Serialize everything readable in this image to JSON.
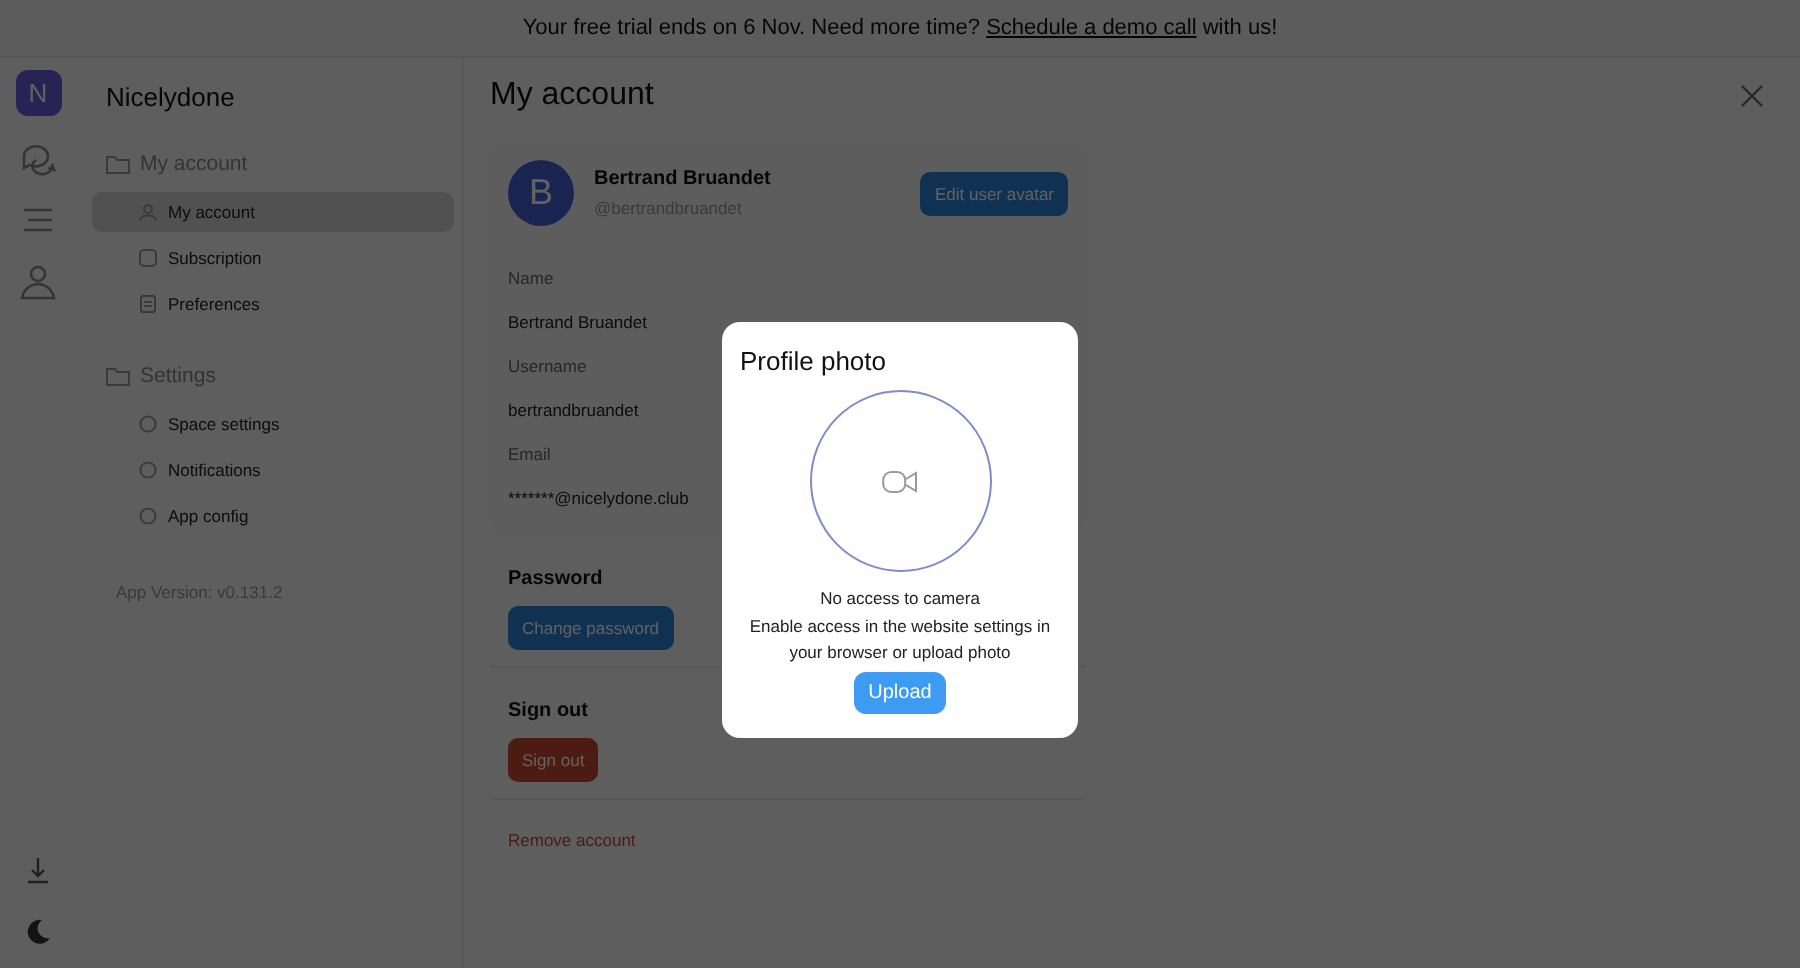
{
  "banner": {
    "before": "Your free trial ends on 6 Nov. Need more time?",
    "link": "Schedule a demo call",
    "after": "with us!"
  },
  "rail": {
    "workspace_initial": "N"
  },
  "sidebar": {
    "title": "Nicelydone",
    "groups": [
      {
        "label": "My account",
        "items": [
          {
            "label": "My account",
            "selected": true
          },
          {
            "label": "Subscription",
            "selected": false
          },
          {
            "label": "Preferences",
            "selected": false
          }
        ]
      },
      {
        "label": "Settings",
        "items": [
          {
            "label": "Space settings",
            "selected": false
          },
          {
            "label": "Notifications",
            "selected": false
          },
          {
            "label": "App config",
            "selected": false
          }
        ]
      }
    ],
    "version": "App Version: v0.131.2"
  },
  "main": {
    "title": "My account",
    "profile": {
      "avatar_initial": "B",
      "name": "Bertrand Bruandet",
      "handle": "@bertrandbruandet",
      "edit_button": "Edit user avatar"
    },
    "fields": [
      {
        "label": "Name",
        "value": "Bertrand Bruandet"
      },
      {
        "label": "Username",
        "value": "bertrandbruandet"
      },
      {
        "label": "Email",
        "value": "*******@nicelydone.club"
      }
    ],
    "sections": [
      {
        "kind": "primary",
        "heading": "Password",
        "button": "Change password"
      },
      {
        "kind": "danger",
        "heading": "Sign out",
        "button": "Sign out"
      }
    ],
    "remove_link": "Remove account"
  },
  "modal": {
    "title": "Profile photo",
    "message": "No access to camera",
    "hint": "Enable access in the website settings in your browser or upload photo",
    "button": "Upload"
  }
}
